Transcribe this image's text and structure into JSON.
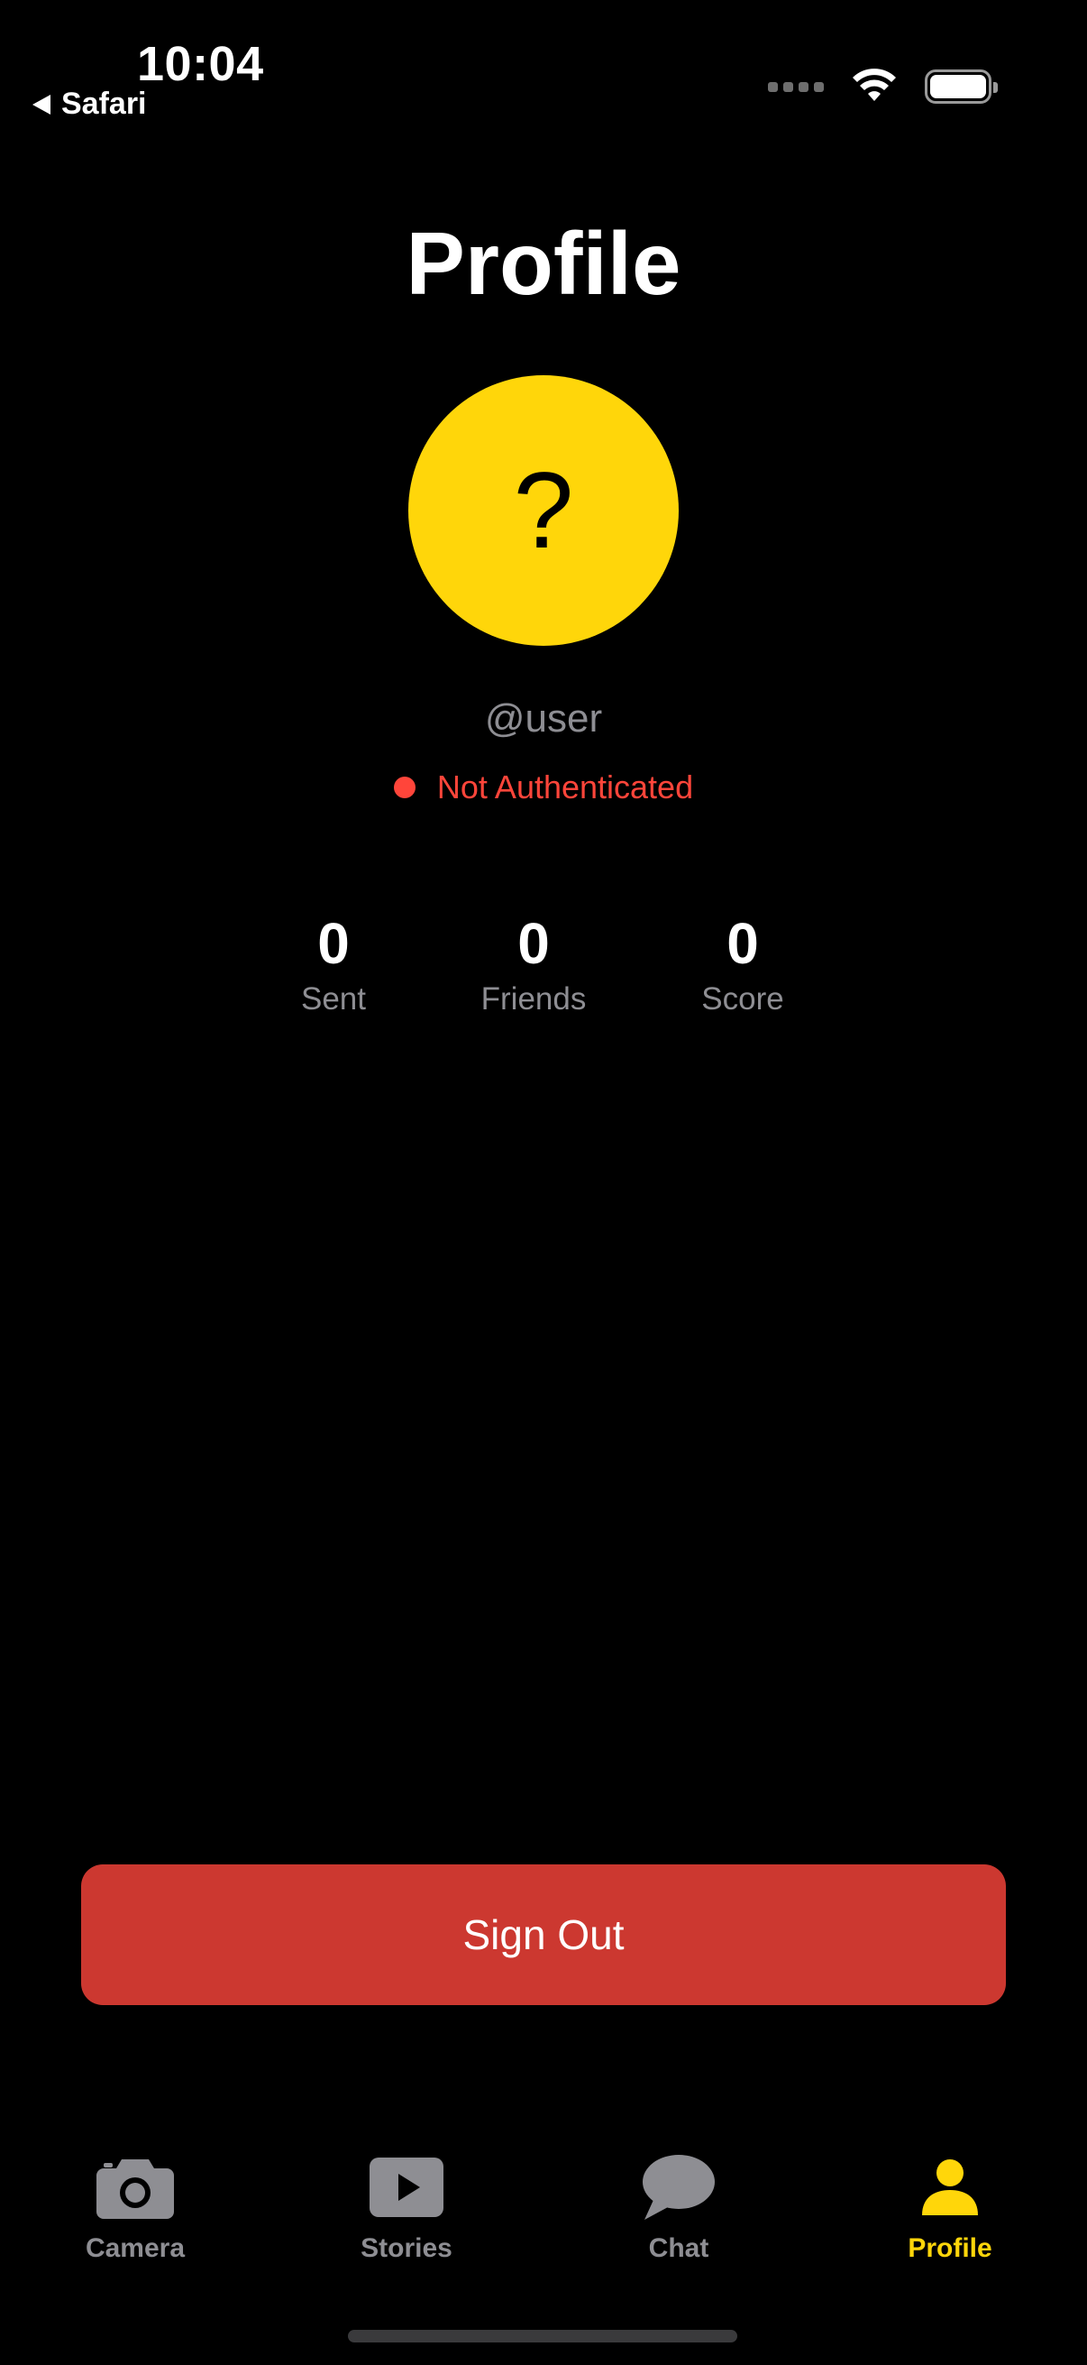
{
  "status_bar": {
    "time": "10:04",
    "back_app": "Safari"
  },
  "header": {
    "title": "Profile"
  },
  "profile": {
    "avatar_symbol": "?",
    "avatar_color": "#ffd60a",
    "username": "@user",
    "auth_status": "Not Authenticated",
    "auth_status_color": "#ff453a"
  },
  "stats": [
    {
      "value": "0",
      "label": "Sent"
    },
    {
      "value": "0",
      "label": "Friends"
    },
    {
      "value": "0",
      "label": "Score"
    }
  ],
  "actions": {
    "sign_out_label": "Sign Out",
    "sign_out_color": "#cc3830"
  },
  "tab_bar": {
    "active_color": "#ffd60a",
    "tabs": [
      {
        "label": "Camera",
        "icon": "camera-icon",
        "active": false
      },
      {
        "label": "Stories",
        "icon": "play-icon",
        "active": false
      },
      {
        "label": "Chat",
        "icon": "chat-bubble-icon",
        "active": false
      },
      {
        "label": "Profile",
        "icon": "person-icon",
        "active": true
      }
    ]
  }
}
